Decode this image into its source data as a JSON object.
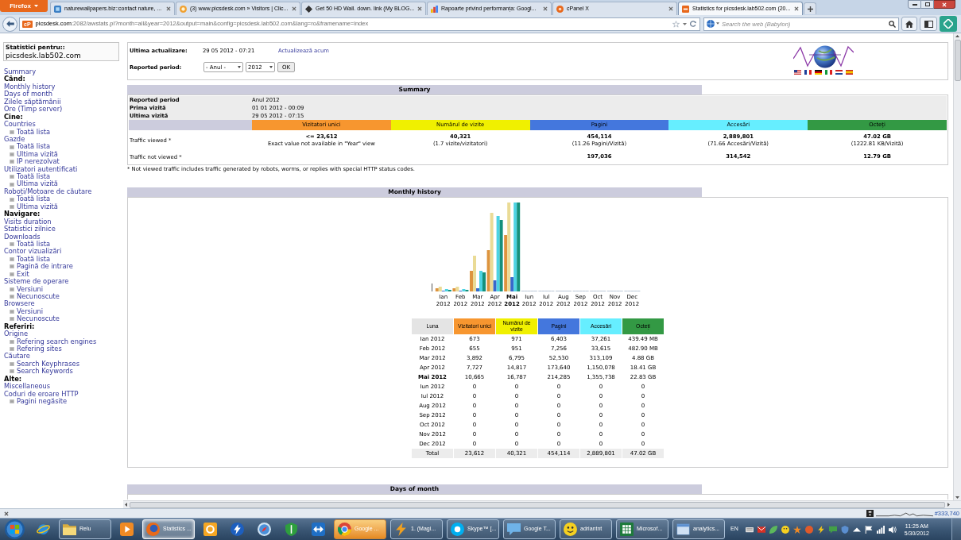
{
  "browser": {
    "menu_button": "Firefox",
    "tabs": [
      {
        "title": "naturewallpapers.biz::contact nature, ...",
        "selected": false
      },
      {
        "title": "(3) www.picsdesk.com » Visitors | Clic...",
        "selected": false
      },
      {
        "title": "Get 50 HD Wall. down. link (My BLOG...",
        "selected": false
      },
      {
        "title": "Rapoarte privind performanța: Googl...",
        "selected": false
      },
      {
        "title": "cPanel X",
        "selected": false
      },
      {
        "title": "Statistics for picsdesk.lab502.com (20...",
        "selected": true
      }
    ],
    "address": {
      "badge": "cP",
      "host": "picsdesk.com",
      "path": ":2082/awstats.pl?month=all&year=2012&output=main&config=picsdesk.lab502.com&lang=ro&framename=index"
    },
    "search": {
      "placeholder": "Search the web (Babylon)"
    }
  },
  "sidebar": {
    "title": "Statistici pentru::",
    "site": "picsdesk.lab502.com",
    "items": [
      {
        "kind": "link",
        "label": "Summary"
      },
      {
        "kind": "heading",
        "label": "Când:"
      },
      {
        "kind": "link",
        "label": "Monthly history"
      },
      {
        "kind": "link",
        "label": "Days of month"
      },
      {
        "kind": "link",
        "label": "Zilele săptămânii"
      },
      {
        "kind": "link",
        "label": "Ore (Timp server)"
      },
      {
        "kind": "heading",
        "label": "Cine:"
      },
      {
        "kind": "link",
        "label": "Countries",
        "children": [
          {
            "label": "Toată lista"
          }
        ]
      },
      {
        "kind": "link",
        "label": "Gazde",
        "children": [
          {
            "label": "Toată lista"
          },
          {
            "label": "Ultima vizită"
          },
          {
            "label": "IP nerezolvat"
          }
        ]
      },
      {
        "kind": "link",
        "label": "Utilizatori autentificati",
        "children": [
          {
            "label": "Toată lista"
          },
          {
            "label": "Ultima vizită"
          }
        ]
      },
      {
        "kind": "link",
        "label": "Roboți/Motoare de căutare",
        "children": [
          {
            "label": "Toată lista"
          },
          {
            "label": "Ultima vizită"
          }
        ]
      },
      {
        "kind": "heading",
        "label": "Navigare:"
      },
      {
        "kind": "link",
        "label": "Visits duration"
      },
      {
        "kind": "link",
        "label": "Statistici zilnice"
      },
      {
        "kind": "link",
        "label": "Downloads",
        "children": [
          {
            "label": "Toată lista"
          }
        ]
      },
      {
        "kind": "link",
        "label": "Contor vizualizări",
        "children": [
          {
            "label": "Toată lista"
          },
          {
            "label": "Pagină de intrare"
          },
          {
            "label": "Exit"
          }
        ]
      },
      {
        "kind": "link",
        "label": "Sisteme de operare",
        "children": [
          {
            "label": "Versiuni"
          },
          {
            "label": "Necunoscute"
          }
        ]
      },
      {
        "kind": "link",
        "label": "Browsere",
        "children": [
          {
            "label": "Versiuni"
          },
          {
            "label": "Necunoscute"
          }
        ]
      },
      {
        "kind": "heading",
        "label": "Referiri:"
      },
      {
        "kind": "link",
        "label": "Origine",
        "children": [
          {
            "label": "Refering search engines"
          },
          {
            "label": "Refering sites"
          }
        ]
      },
      {
        "kind": "link",
        "label": "Căutare",
        "children": [
          {
            "label": "Search Keyphrases"
          },
          {
            "label": "Search Keywords"
          }
        ]
      },
      {
        "kind": "heading",
        "label": "Alte:"
      },
      {
        "kind": "link",
        "label": "Miscellaneous"
      },
      {
        "kind": "link",
        "label": "Coduri de eroare HTTP",
        "children": [
          {
            "label": "Pagini negăsite"
          }
        ]
      }
    ]
  },
  "header": {
    "last_update": {
      "label": "Ultima actualizare:",
      "value": "29 05 2012 - 07:21",
      "link": "Actualizează acum"
    },
    "period": {
      "label": "Reported period:",
      "month": "- Anul -",
      "year": "2012",
      "button": "OK"
    }
  },
  "summary": {
    "title": "Summary",
    "info": [
      {
        "label": "Reported period",
        "value": "Anul 2012"
      },
      {
        "label": "Prima vizită",
        "value": "01 01 2012 - 00:09"
      },
      {
        "label": "Ultima vizită",
        "value": "29 05 2012 - 07:15"
      }
    ],
    "columns": [
      {
        "label": "Vizitatori unici",
        "color": "#f7962f"
      },
      {
        "label": "Numărul de vizite",
        "color": "#f0f000"
      },
      {
        "label": "Pagini",
        "color": "#4477dd"
      },
      {
        "label": "Accesări",
        "color": "#66eeff"
      },
      {
        "label": "Octeți",
        "color": "#339944"
      }
    ],
    "rows": [
      {
        "label": "Traffic viewed *",
        "cells": [
          {
            "value": "<= 23,612",
            "detail": "Exact value not available in \"Year\" view"
          },
          {
            "value": "40,321",
            "detail": "(1.7 vizite/vizitatori)"
          },
          {
            "value": "454,114",
            "detail": "(11.26 Pagini/Vizită)"
          },
          {
            "value": "2,889,801",
            "detail": "(71.66 Accesări/Vizită)"
          },
          {
            "value": "47.02 GB",
            "detail": "(1222.81 KB/Vizită)"
          }
        ]
      },
      {
        "label": "Traffic not viewed *",
        "cells": [
          null,
          null,
          {
            "value": "197,036"
          },
          {
            "value": "314,542"
          },
          {
            "value": "12.79 GB"
          }
        ]
      }
    ],
    "note": "* Not viewed traffic includes traffic generated by robots, worms, or replies with special HTTP status codes."
  },
  "monthly_history": {
    "title": "Monthly history",
    "chart": {
      "labels": [
        {
          "text": "Ian 2012",
          "current": false
        },
        {
          "text": "Feb 2012",
          "current": false
        },
        {
          "text": "Mar 2012",
          "current": false
        },
        {
          "text": "Apr 2012",
          "current": false
        },
        {
          "text": "Mai 2012",
          "current": true
        },
        {
          "text": "Iun 2012",
          "current": false
        },
        {
          "text": "Iul 2012",
          "current": false
        },
        {
          "text": "Aug 2012",
          "current": false
        },
        {
          "text": "Sep 2012",
          "current": false
        },
        {
          "text": "Oct 2012",
          "current": false
        },
        {
          "text": "Nov 2012",
          "current": false
        },
        {
          "text": "Dec 2012",
          "current": false
        }
      ]
    },
    "table": {
      "columns": [
        {
          "label": "Luna",
          "color": "#e4e4e4"
        },
        {
          "label": "Vizitatori unici",
          "color": "#f7962f"
        },
        {
          "label": "Numărul de vizite",
          "color": "#f0f000"
        },
        {
          "label": "Pagini",
          "color": "#4477dd"
        },
        {
          "label": "Accesări",
          "color": "#66eeff"
        },
        {
          "label": "Octeți",
          "color": "#339944"
        }
      ],
      "rows": [
        {
          "month": "Ian 2012",
          "current": false,
          "values": [
            "673",
            "971",
            "6,403",
            "37,261",
            "439.49 MB"
          ]
        },
        {
          "month": "Feb 2012",
          "current": false,
          "values": [
            "655",
            "951",
            "7,256",
            "33,615",
            "482.90 MB"
          ]
        },
        {
          "month": "Mar 2012",
          "current": false,
          "values": [
            "3,892",
            "6,795",
            "52,530",
            "313,109",
            "4.88 GB"
          ]
        },
        {
          "month": "Apr 2012",
          "current": false,
          "values": [
            "7,727",
            "14,817",
            "173,640",
            "1,150,078",
            "18.41 GB"
          ]
        },
        {
          "month": "Mai 2012",
          "current": true,
          "values": [
            "10,665",
            "16,787",
            "214,285",
            "1,355,738",
            "22.83 GB"
          ]
        },
        {
          "month": "Iun 2012",
          "current": false,
          "values": [
            "0",
            "0",
            "0",
            "0",
            "0"
          ]
        },
        {
          "month": "Iul 2012",
          "current": false,
          "values": [
            "0",
            "0",
            "0",
            "0",
            "0"
          ]
        },
        {
          "month": "Aug 2012",
          "current": false,
          "values": [
            "0",
            "0",
            "0",
            "0",
            "0"
          ]
        },
        {
          "month": "Sep 2012",
          "current": false,
          "values": [
            "0",
            "0",
            "0",
            "0",
            "0"
          ]
        },
        {
          "month": "Oct 2012",
          "current": false,
          "values": [
            "0",
            "0",
            "0",
            "0",
            "0"
          ]
        },
        {
          "month": "Nov 2012",
          "current": false,
          "values": [
            "0",
            "0",
            "0",
            "0",
            "0"
          ]
        },
        {
          "month": "Dec 2012",
          "current": false,
          "values": [
            "0",
            "0",
            "0",
            "0",
            "0"
          ]
        }
      ],
      "total": {
        "label": "Total",
        "values": [
          "23,612",
          "40,321",
          "454,114",
          "2,889,801",
          "47.02 GB"
        ]
      }
    }
  },
  "days_of_month": {
    "title": "Days of month"
  },
  "status_bar": {
    "counter": "#333,740"
  },
  "taskbar": {
    "items": [
      {
        "kind": "pinned",
        "selected": false,
        "attention": false
      },
      {
        "kind": "window",
        "label": "Relu",
        "selected": false,
        "attention": false
      },
      {
        "kind": "pinned",
        "selected": false,
        "attention": false
      },
      {
        "kind": "window",
        "label": "Statistics ...",
        "selected": true,
        "attention": false
      },
      {
        "kind": "pinned",
        "selected": false,
        "attention": false
      },
      {
        "kind": "pinned",
        "selected": false,
        "attention": false
      },
      {
        "kind": "pinned",
        "selected": false,
        "attention": false
      },
      {
        "kind": "pinned",
        "selected": false,
        "attention": false
      },
      {
        "kind": "pinned",
        "selected": false,
        "attention": false
      },
      {
        "kind": "window",
        "label": "Google ...",
        "selected": false,
        "attention": true
      },
      {
        "kind": "window",
        "label": "1. (Magi...",
        "selected": false,
        "attention": false
      },
      {
        "kind": "window",
        "label": "Skype™ [...",
        "selected": false,
        "attention": false
      },
      {
        "kind": "window",
        "label": "Google T...",
        "selected": false,
        "attention": false
      },
      {
        "kind": "window",
        "label": "adriantnt",
        "selected": false,
        "attention": false
      },
      {
        "kind": "window",
        "label": "Microsof...",
        "selected": false,
        "attention": false
      },
      {
        "kind": "window",
        "label": "analytics...",
        "selected": false,
        "attention": false
      }
    ],
    "language": "EN",
    "time": "11:25 AM",
    "date": "5/30/2012"
  }
}
